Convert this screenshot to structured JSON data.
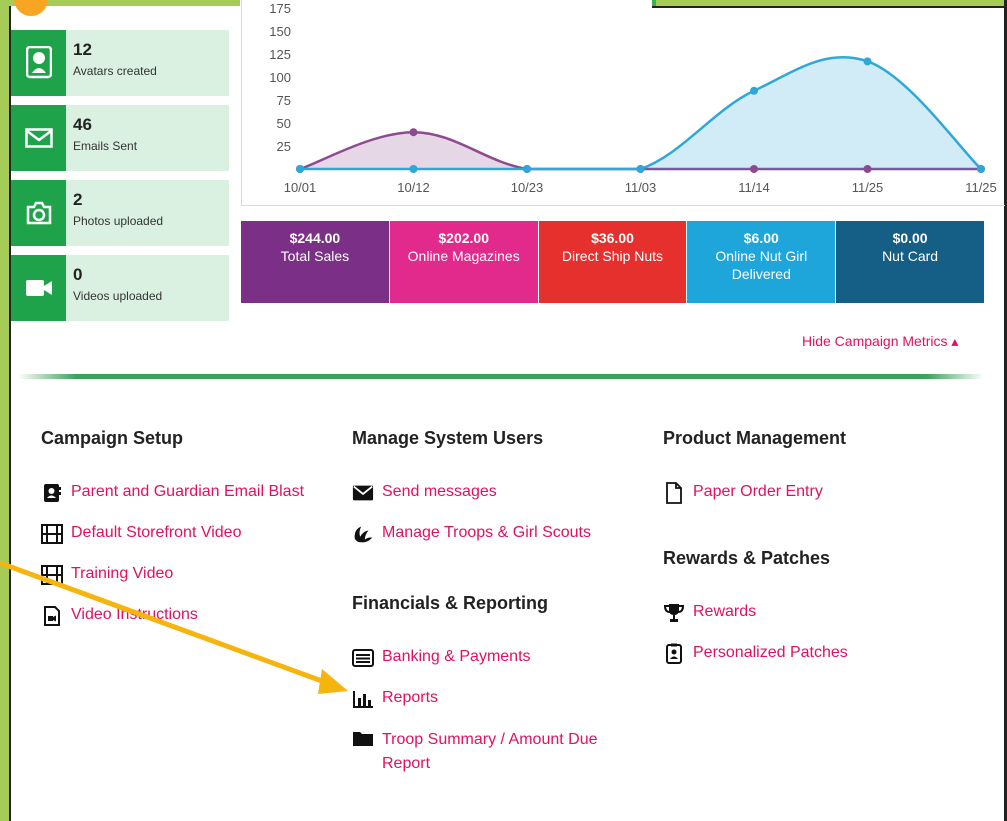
{
  "stats": [
    {
      "value": "12",
      "label": "Avatars created",
      "icon": "avatar-icon"
    },
    {
      "value": "46",
      "label": "Emails Sent",
      "icon": "envelope-icon"
    },
    {
      "value": "2",
      "label": "Photos uploaded",
      "icon": "camera-icon"
    },
    {
      "value": "0",
      "label": "Videos uploaded",
      "icon": "video-camera-icon"
    }
  ],
  "chart_data": {
    "type": "area",
    "categories": [
      "10/01",
      "10/12",
      "10/23",
      "11/03",
      "11/14",
      "11/25",
      "11/25"
    ],
    "y_ticks": [
      "175",
      "150",
      "125",
      "100",
      "75",
      "50",
      "25"
    ],
    "ylim": [
      0,
      175
    ],
    "series": [
      {
        "color": "#8e4a8f",
        "values": [
          0,
          40,
          0,
          0,
          0,
          0,
          0
        ]
      },
      {
        "color": "#2fa7d8",
        "values": [
          0,
          0,
          0,
          0,
          85,
          117,
          0
        ]
      }
    ]
  },
  "tiles": [
    {
      "amount": "$244.00",
      "label": "Total Sales",
      "color": "#7b2f86"
    },
    {
      "amount": "$202.00",
      "label": "Online Magazines",
      "color": "#e12a8c"
    },
    {
      "amount": "$36.00",
      "label": "Direct Ship Nuts",
      "color": "#e5302d"
    },
    {
      "amount": "$6.00",
      "label": "Online Nut Girl Delivered",
      "color": "#1ea6db"
    },
    {
      "amount": "$0.00",
      "label": "Nut Card",
      "color": "#155e86"
    }
  ],
  "hide_metrics": "Hide Campaign Metrics ▴",
  "sections": {
    "campaign_setup": {
      "title": "Campaign Setup",
      "links": [
        "Parent and Guardian Email Blast",
        "Default Storefront Video",
        "Training Video",
        "Video Instructions"
      ]
    },
    "manage_users": {
      "title": "Manage System Users",
      "links": [
        "Send messages",
        "Manage Troops & Girl Scouts"
      ]
    },
    "financials": {
      "title": "Financials & Reporting",
      "links": [
        "Banking & Payments",
        "Reports",
        "Troop Summary / Amount Due",
        "Report"
      ]
    },
    "product_management": {
      "title": "Product Management",
      "links": [
        "Paper Order Entry"
      ]
    },
    "rewards": {
      "title": "Rewards & Patches",
      "links": [
        "Rewards",
        "Personalized Patches"
      ]
    }
  },
  "colors": {
    "link": "#e0115f",
    "green": "#1fa34a",
    "frame": "#a4cc56",
    "arrow": "#f6b40e"
  }
}
